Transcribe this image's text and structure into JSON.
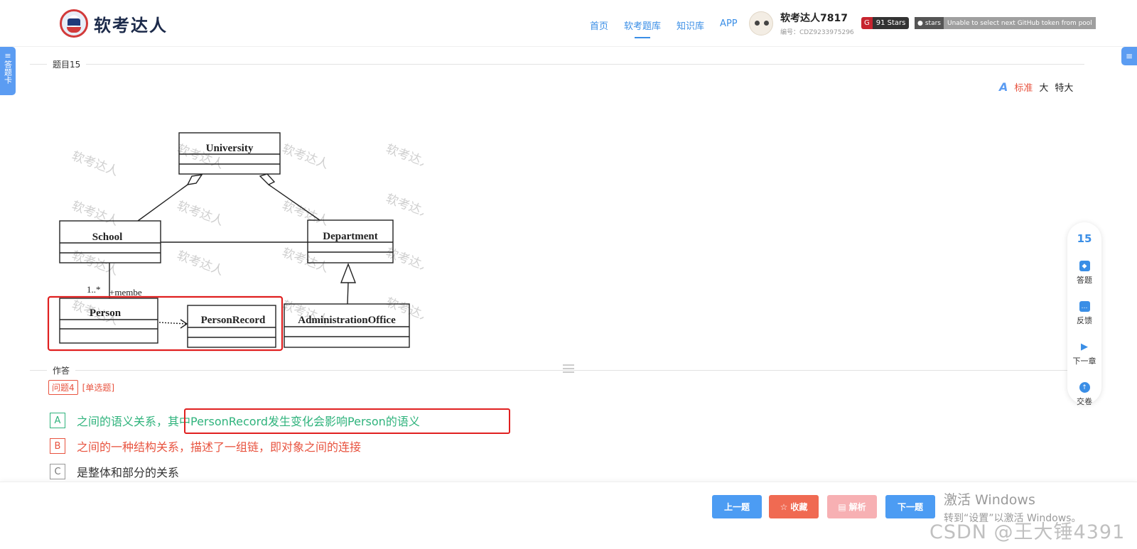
{
  "header": {
    "logo_text": "软考达人",
    "nav": [
      "首页",
      "软考题库",
      "知识库",
      "APP"
    ],
    "nav_active_index": 1,
    "user_name": "软考达人7817",
    "user_id": "编号：CDZ9233975296",
    "stars_badge": "91 Stars",
    "gh_label": "stars",
    "gh_message": "Unable to select next GitHub token from pool"
  },
  "left_tab": {
    "label": "答题卡"
  },
  "question_section": {
    "title": "题目15"
  },
  "font_switch": {
    "options": [
      "标准",
      "大",
      "特大"
    ],
    "active": "标准"
  },
  "uml": {
    "classes": [
      "University",
      "School",
      "Department",
      "Person",
      "PersonRecord",
      "AdministrationOffice"
    ],
    "multiplicity": "1..*",
    "role": "+membe",
    "watermark": "软考达人"
  },
  "answer_section": {
    "title": "作答"
  },
  "question": {
    "num": "问题4",
    "type": "[单选题]",
    "options": [
      {
        "key": "A",
        "text": "之间的语义关系，其中PersonRecord发生变化会影响Person的语义",
        "state": "correct"
      },
      {
        "key": "B",
        "text": "之间的一种结构关系，描述了一组链，即对象之间的连接",
        "state": "wrong"
      },
      {
        "key": "C",
        "text": "是整体和部分的关系",
        "state": "normal"
      }
    ]
  },
  "float_panel": {
    "number": "15",
    "items": [
      "答题",
      "反馈",
      "下一章",
      "交卷"
    ]
  },
  "bottom": {
    "prev": "上一题",
    "fav": "收藏",
    "analyze": "解析",
    "next": "下一题"
  },
  "watermarks": {
    "win_line1": "激活 Windows",
    "win_line2": "转到“设置”以激活 Windows。",
    "csdn": "CSDN @王大锤4391"
  },
  "colors": {
    "primary": "#3a8ee6",
    "correct": "#2fb37c",
    "wrong": "#e8533f",
    "highlight": "#e02020"
  }
}
